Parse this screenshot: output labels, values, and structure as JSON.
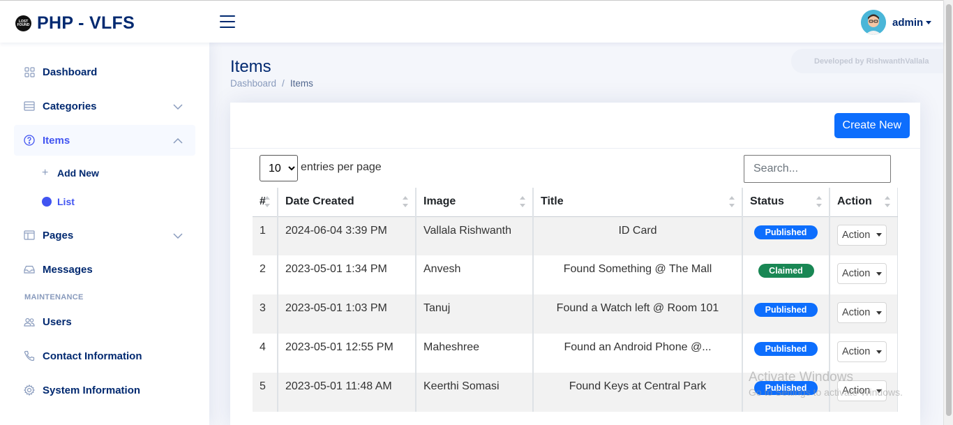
{
  "app": {
    "logo_badge": "LOST FOUND",
    "title": "PHP - VLFS",
    "user": "admin"
  },
  "sidebar": {
    "items": [
      {
        "label": "Dashboard",
        "icon": "grid-icon"
      },
      {
        "label": "Categories",
        "icon": "list-icon"
      },
      {
        "label": "Items",
        "icon": "question-circle-icon"
      },
      {
        "label": "Pages",
        "icon": "layout-icon"
      },
      {
        "label": "Messages",
        "icon": "inbox-icon"
      },
      {
        "label": "Users",
        "icon": "people-icon"
      },
      {
        "label": "Contact Information",
        "icon": "telephone-icon"
      },
      {
        "label": "System Information",
        "icon": "gear-icon"
      }
    ],
    "sub_items": [
      {
        "label": "Add New"
      },
      {
        "label": "List"
      }
    ],
    "maintenance_heading": "MAINTENANCE"
  },
  "page": {
    "title": "Items",
    "breadcrumb": [
      "Dashboard",
      "Items"
    ],
    "developer_note": "Developed by RishwanthVallala"
  },
  "toolbar": {
    "create_label": "Create New",
    "entries_value": "10",
    "entries_label": "entries per page",
    "search_placeholder": "Search..."
  },
  "table": {
    "headers": [
      "#",
      "Date Created",
      "Image",
      "Title",
      "Status",
      "Action"
    ],
    "rows": [
      {
        "n": "1",
        "date": "2024-06-04 3:39 PM",
        "image": "Vallala Rishwanth",
        "title": "ID Card",
        "status": "Published",
        "action": "Action"
      },
      {
        "n": "2",
        "date": "2023-05-01 1:34 PM",
        "image": "Anvesh",
        "title": "Found Something @ The Mall",
        "status": "Claimed",
        "action": "Action"
      },
      {
        "n": "3",
        "date": "2023-05-01 1:03 PM",
        "image": "Tanuj",
        "title": "Found a Watch left @ Room 101",
        "status": "Published",
        "action": "Action"
      },
      {
        "n": "4",
        "date": "2023-05-01 12:55 PM",
        "image": "Maheshree",
        "title": "Found an Android Phone @...",
        "status": "Published",
        "action": "Action"
      },
      {
        "n": "5",
        "date": "2023-05-01 11:48 AM",
        "image": "Keerthi Somasi",
        "title": "Found Keys at Central Park",
        "status": "Published",
        "action": "Action"
      }
    ]
  },
  "watermark": {
    "line1": "Activate Windows",
    "line2": "Go to Settings to activate Windows."
  },
  "colors": {
    "brand": "#012970",
    "accent": "#4154f1",
    "primary": "#0d6efd",
    "success": "#198754"
  }
}
